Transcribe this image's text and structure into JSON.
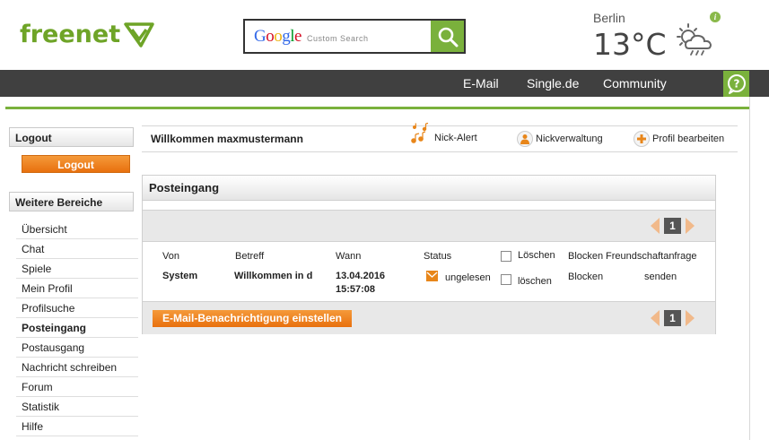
{
  "header": {
    "logo_text": "freenet",
    "search": {
      "brand": "Google",
      "custom_label": "Custom Search"
    },
    "weather": {
      "city": "Berlin",
      "temperature": "13°C",
      "icon": "partly-cloudy-rain-icon",
      "info_label": "i"
    }
  },
  "nav": {
    "items": [
      "E-Mail",
      "Single.de",
      "Community"
    ],
    "help_label": "?"
  },
  "colors": {
    "accent_green": "#7ab13c",
    "nav_bg": "#404040",
    "button_orange": "#ee7f1a"
  },
  "sidebar": {
    "logout_header": "Logout",
    "logout_button": "Logout",
    "more_header": "Weitere Bereiche",
    "items": [
      "Übersicht",
      "Chat",
      "Spiele",
      "Mein Profil",
      "Profilsuche",
      "Posteingang",
      "Postausgang",
      "Nachricht schreiben",
      "Forum",
      "Statistik",
      "Hilfe"
    ],
    "active_item": "Posteingang"
  },
  "welcome": {
    "text": "Willkommen maxmustermann",
    "actions": [
      "Nick-Alert",
      "Nickverwaltung",
      "Profil bearbeiten"
    ]
  },
  "inbox": {
    "title": "Posteingang",
    "page": "1",
    "columns": {
      "from": "Von",
      "subject": "Betreff",
      "when": "Wann",
      "status": "Status",
      "delete": "Löschen",
      "block": "Blocken",
      "friend": "Freundschaftanfrage"
    },
    "rows": [
      {
        "from": "System",
        "subject": "Willkommen in d",
        "date": "13.04.2016",
        "time": "15:57:08",
        "status": "ungelesen",
        "delete": "löschen",
        "block": "Blocken",
        "friend": "senden"
      }
    ],
    "notify_button": "E-Mail-Benachrichtigung einstellen"
  }
}
